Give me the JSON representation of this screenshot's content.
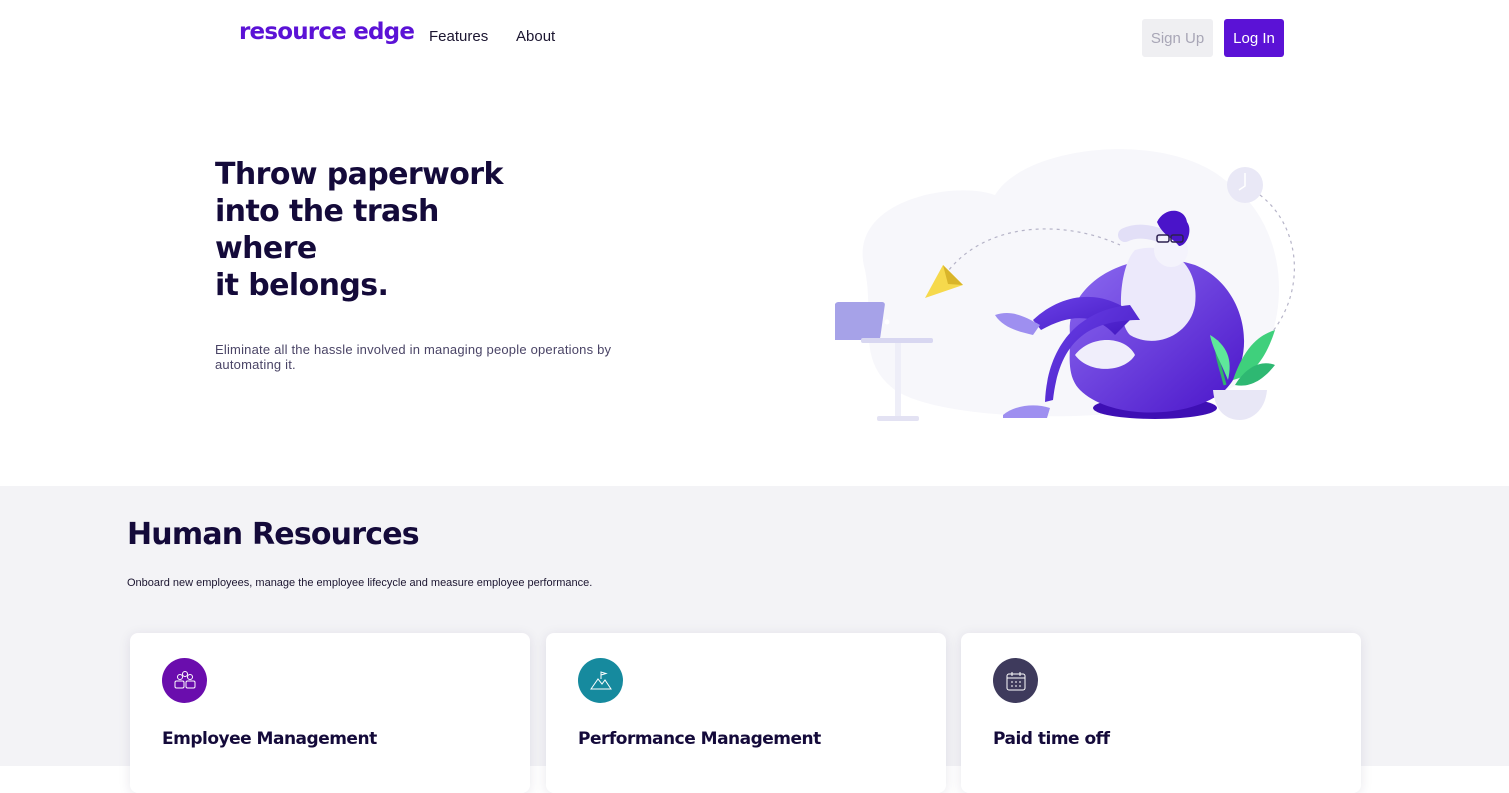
{
  "header": {
    "logo": "resource edge",
    "nav": [
      "Features",
      "About"
    ],
    "signup_label": "Sign Up",
    "login_label": "Log In"
  },
  "hero": {
    "title_lines": [
      "Throw paperwork",
      "into the trash where",
      "it belongs."
    ],
    "subtitle": "Eliminate all the hassle involved in managing people operations by automating it."
  },
  "hr": {
    "title": "Human Resources",
    "subtitle": "Onboard new employees, manage the employee lifecycle and measure employee performance.",
    "cards": [
      {
        "title": "Employee Management",
        "icon": "team-icon",
        "color": "#6a0dad"
      },
      {
        "title": "Performance Management",
        "icon": "mountain-flag-icon",
        "color": "#168a9e"
      },
      {
        "title": "Paid time off",
        "icon": "calendar-icon",
        "color": "#3e3a5c"
      }
    ]
  },
  "colors": {
    "brand": "#5b12d6",
    "heading": "#140a3a",
    "section_bg": "#f3f3f6"
  }
}
